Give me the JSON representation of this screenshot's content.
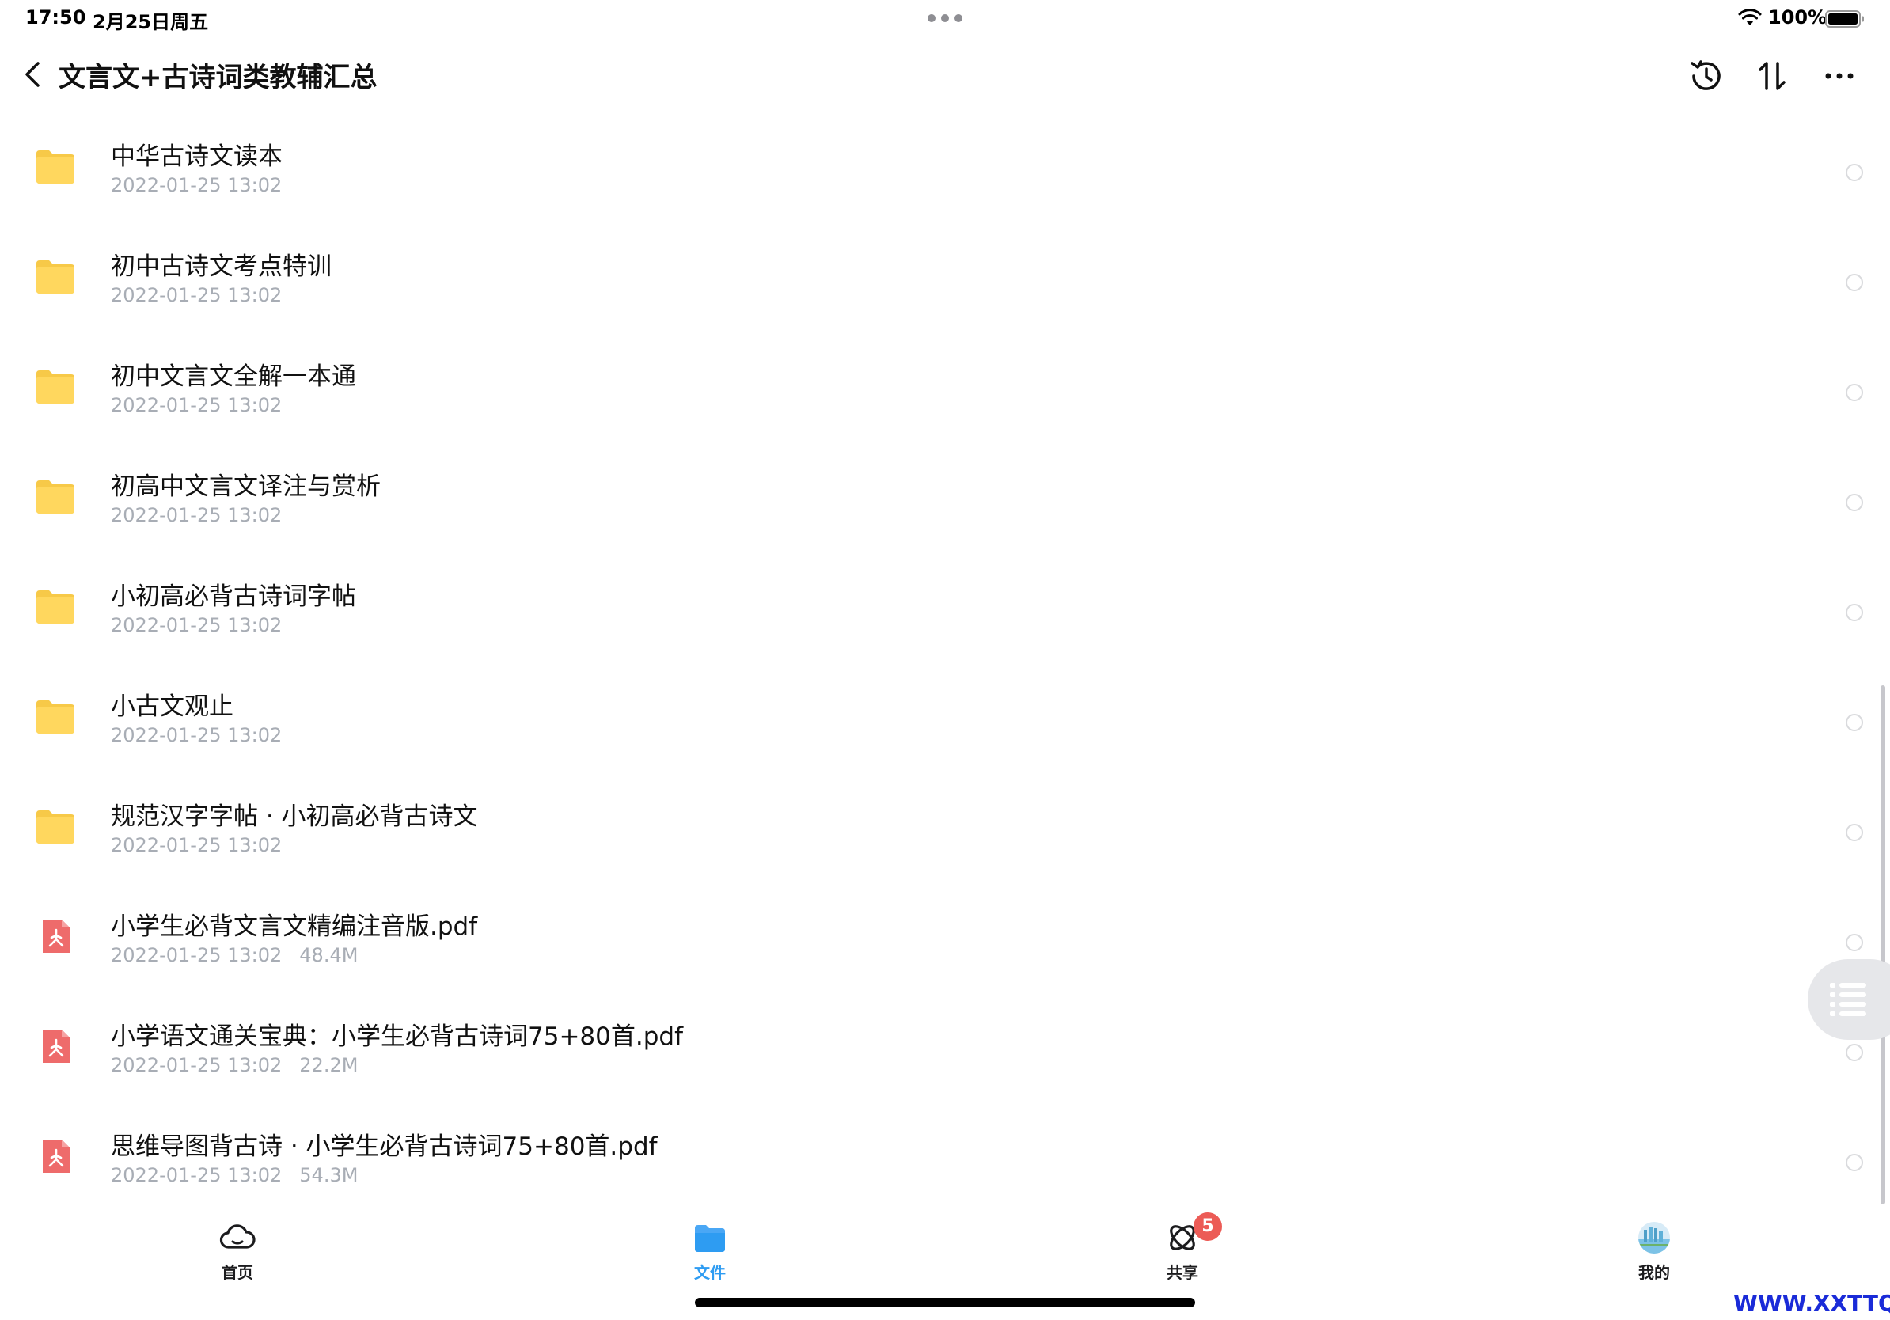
{
  "status_bar": {
    "time": "17:50",
    "date": "2月25日周五",
    "battery_percent": "100%",
    "battery_level": 1.0
  },
  "header": {
    "title": "文言文+古诗词类教辅汇总"
  },
  "files": [
    {
      "type": "folder",
      "name": "中华古诗文读本",
      "date": "2022-01-25 13:02",
      "size": ""
    },
    {
      "type": "folder",
      "name": "初中古诗文考点特训",
      "date": "2022-01-25 13:02",
      "size": ""
    },
    {
      "type": "folder",
      "name": "初中文言文全解一本通",
      "date": "2022-01-25 13:02",
      "size": ""
    },
    {
      "type": "folder",
      "name": "初高中文言文译注与赏析",
      "date": "2022-01-25 13:02",
      "size": ""
    },
    {
      "type": "folder",
      "name": "小初高必背古诗词字帖",
      "date": "2022-01-25 13:02",
      "size": ""
    },
    {
      "type": "folder",
      "name": "小古文观止",
      "date": "2022-01-25 13:02",
      "size": ""
    },
    {
      "type": "folder",
      "name": "规范汉字字帖 · 小初高必背古诗文",
      "date": "2022-01-25 13:02",
      "size": ""
    },
    {
      "type": "pdf",
      "name": "小学生必背文言文精编注音版.pdf",
      "date": "2022-01-25 13:02",
      "size": "48.4M"
    },
    {
      "type": "pdf",
      "name": "小学语文通关宝典：小学生必背古诗词75+80首.pdf",
      "date": "2022-01-25 13:02",
      "size": "22.2M"
    },
    {
      "type": "pdf",
      "name": "思维导图背古诗 · 小学生必背古诗词75+80首.pdf",
      "date": "2022-01-25 13:02",
      "size": "54.3M"
    }
  ],
  "tabs": [
    {
      "label": "首页",
      "icon": "cloud-icon",
      "active": false
    },
    {
      "label": "文件",
      "icon": "folder-icon",
      "active": true
    },
    {
      "label": "共享",
      "icon": "orbit-icon",
      "active": false,
      "badge": "5"
    },
    {
      "label": "我的",
      "icon": "avatar-icon",
      "active": false
    }
  ],
  "watermark": "WWW.XXTTQ.COM",
  "colors": {
    "folder": "#FFD75E",
    "pdf": "#EE6B6B",
    "active_tab": "#2E9CF2",
    "badge": "#EC5B56",
    "meta_text": "#A8ADB5"
  }
}
